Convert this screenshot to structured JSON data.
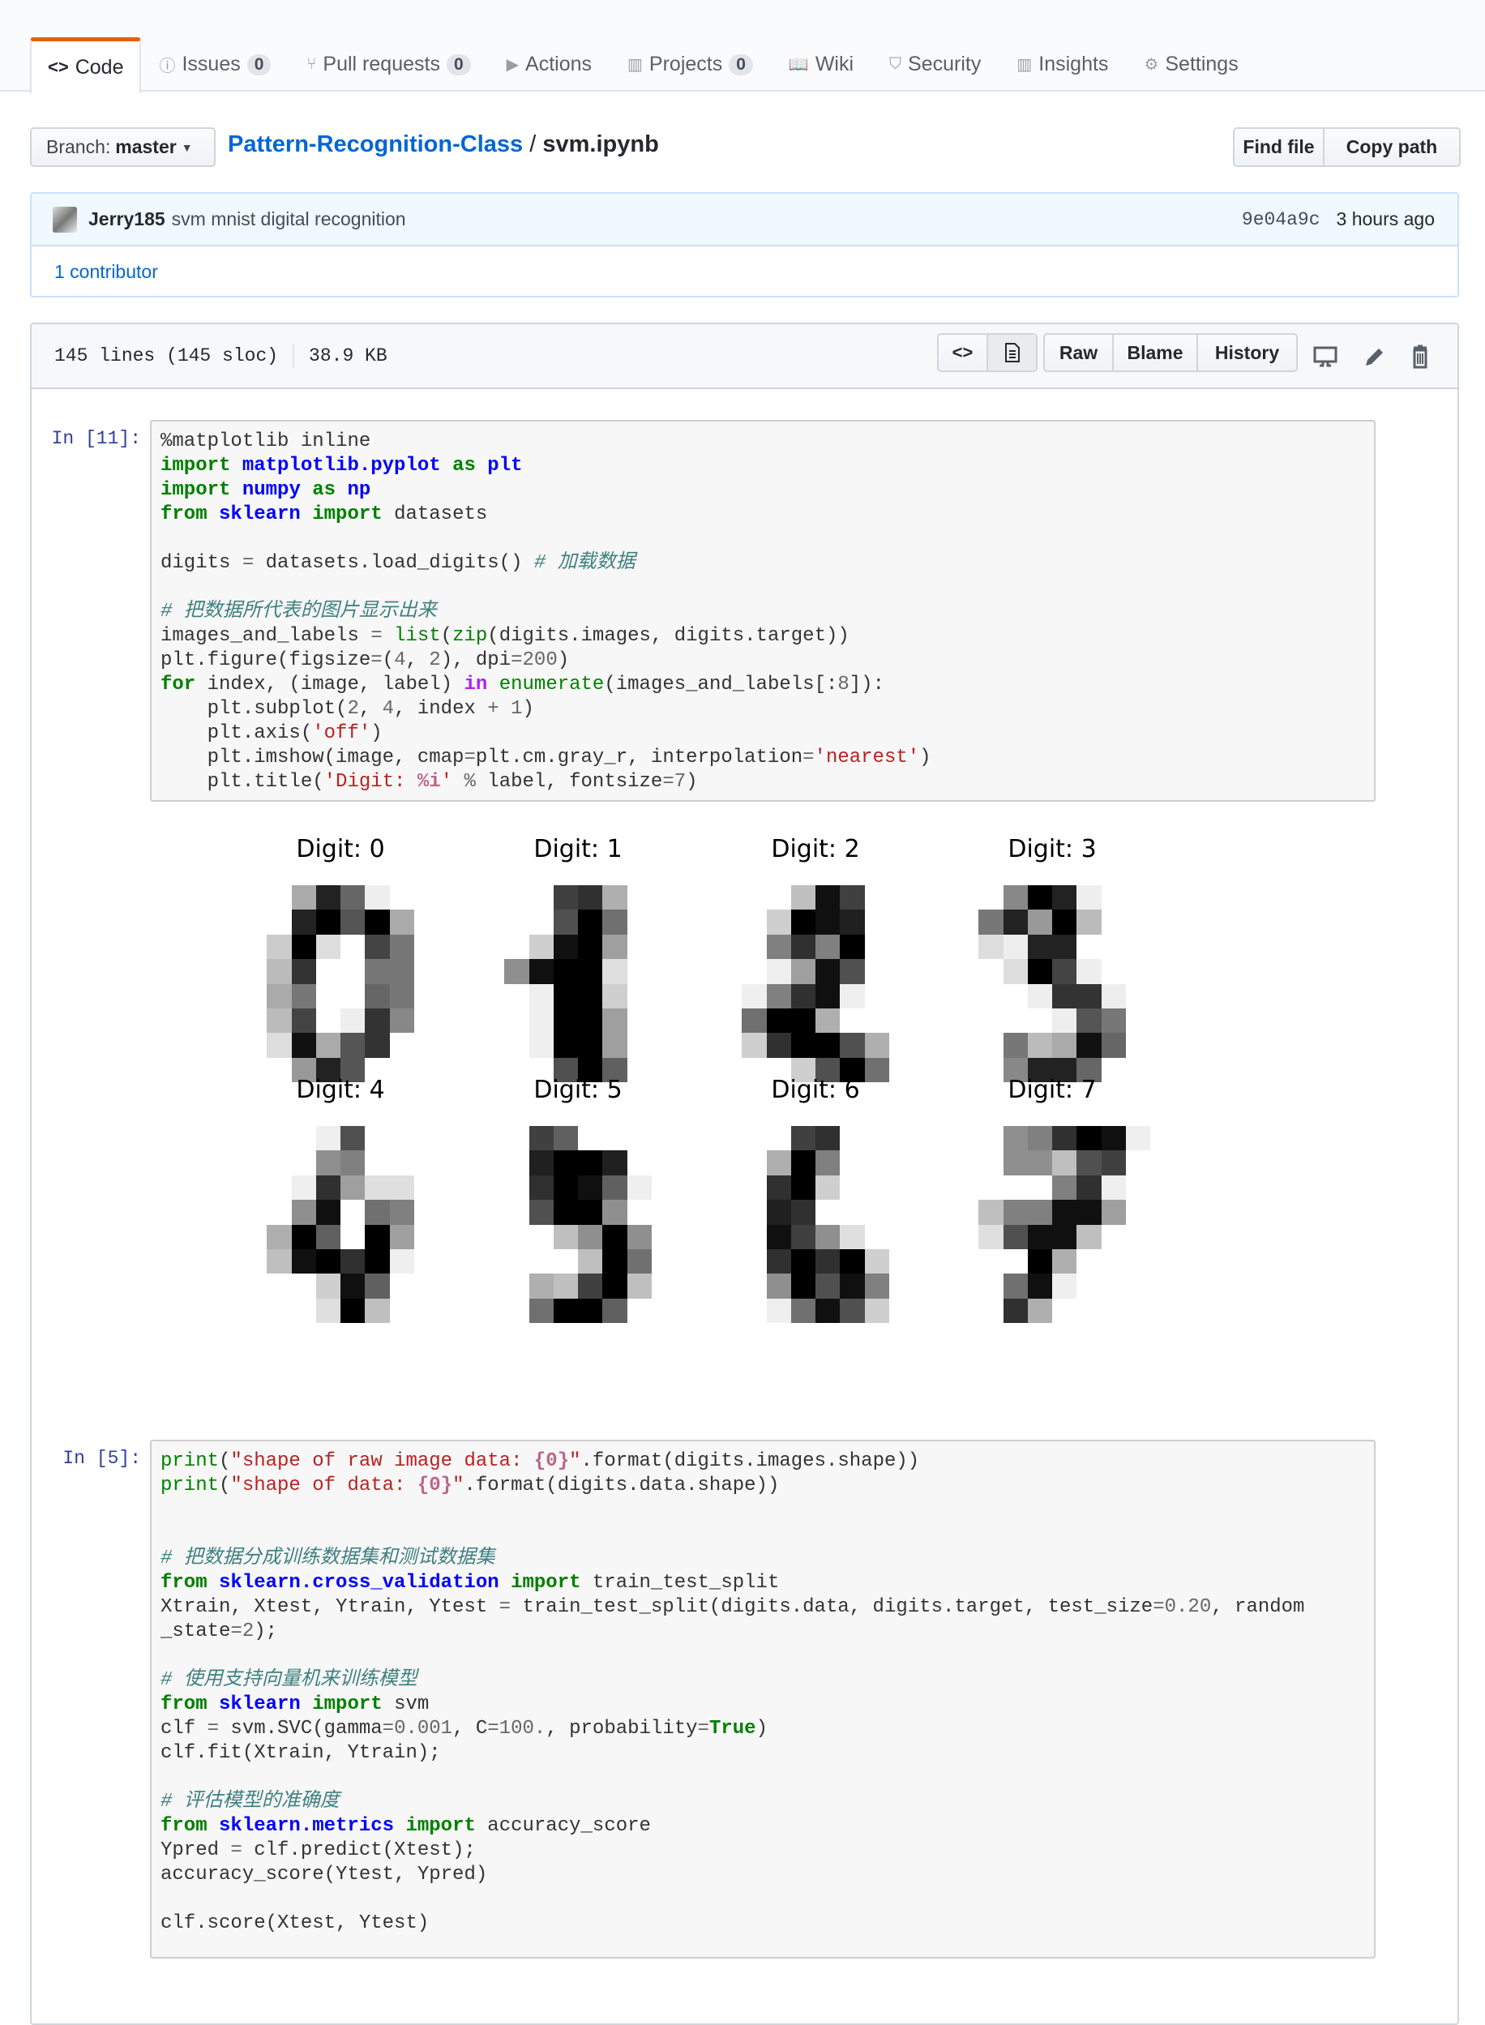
{
  "tabs": [
    {
      "label": "Code",
      "icon": "code-icon",
      "selected": true
    },
    {
      "label": "Issues",
      "count": "0",
      "icon": "issue-icon"
    },
    {
      "label": "Pull requests",
      "count": "0",
      "icon": "pull-request-icon"
    },
    {
      "label": "Actions",
      "icon": "play-icon"
    },
    {
      "label": "Projects",
      "count": "0",
      "icon": "project-icon"
    },
    {
      "label": "Wiki",
      "icon": "book-icon"
    },
    {
      "label": "Security",
      "icon": "shield-icon"
    },
    {
      "label": "Insights",
      "icon": "graph-icon"
    },
    {
      "label": "Settings",
      "icon": "gear-icon"
    }
  ],
  "branch": {
    "label": "Branch:",
    "value": "master"
  },
  "breadcrumb": {
    "repo": "Pattern-Recognition-Class",
    "sep": "/",
    "file": "svm.ipynb"
  },
  "actions": {
    "find_file": "Find file",
    "copy_path": "Copy path"
  },
  "commit": {
    "author": "Jerry185",
    "message": "svm mnist digital recognition",
    "sha": "9e04a9c",
    "time": "3 hours ago",
    "contributors": "1 contributor"
  },
  "file": {
    "lines": "145 lines (145 sloc)",
    "size": "38.9 KB",
    "raw": "Raw",
    "blame": "Blame",
    "history": "History"
  },
  "cells": [
    {
      "prompt": "In [11]:",
      "lines": [
        [
          [
            "%matplotlib inline",
            ""
          ]
        ],
        [
          [
            "import",
            "kw"
          ],
          [
            " ",
            ""
          ],
          [
            "matplotlib.pyplot",
            "nm"
          ],
          [
            " ",
            ""
          ],
          [
            "as",
            "kw"
          ],
          [
            " ",
            ""
          ],
          [
            "plt",
            "nm"
          ]
        ],
        [
          [
            "import",
            "kw"
          ],
          [
            " ",
            ""
          ],
          [
            "numpy",
            "nm"
          ],
          [
            " ",
            ""
          ],
          [
            "as",
            "kw"
          ],
          [
            " ",
            ""
          ],
          [
            "np",
            "nm"
          ]
        ],
        [
          [
            "from",
            "kw"
          ],
          [
            " ",
            ""
          ],
          [
            "sklearn",
            "nm"
          ],
          [
            " ",
            ""
          ],
          [
            "import",
            "kw"
          ],
          [
            " datasets",
            ""
          ]
        ],
        [],
        [
          [
            "digits ",
            ""
          ],
          [
            "=",
            "op"
          ],
          [
            " datasets.load_digits() ",
            ""
          ],
          [
            "# 加载数据",
            "cm"
          ]
        ],
        [],
        [
          [
            "# 把数据所代表的图片显示出来",
            "cm"
          ]
        ],
        [
          [
            "images_and_labels ",
            ""
          ],
          [
            "=",
            "op"
          ],
          [
            " ",
            ""
          ],
          [
            "list",
            "bi"
          ],
          [
            "(",
            ""
          ],
          [
            "zip",
            "bi"
          ],
          [
            "(digits.images, digits.target))",
            ""
          ]
        ],
        [
          [
            "plt.figure(figsize",
            ""
          ],
          [
            "=",
            "op"
          ],
          [
            "(",
            ""
          ],
          [
            "4",
            "num"
          ],
          [
            ", ",
            ""
          ],
          [
            "2",
            "num"
          ],
          [
            "), dpi",
            ""
          ],
          [
            "=",
            "op"
          ],
          [
            "200",
            "num"
          ],
          [
            ")",
            ""
          ]
        ],
        [
          [
            "for",
            "kw"
          ],
          [
            " index, (image, label) ",
            ""
          ],
          [
            "in",
            "ow"
          ],
          [
            " ",
            ""
          ],
          [
            "enumerate",
            "bi"
          ],
          [
            "(images_and_labels[:",
            ""
          ],
          [
            "8",
            "num"
          ],
          [
            "]):",
            ""
          ]
        ],
        [
          [
            "    plt.subplot(",
            ""
          ],
          [
            "2",
            "num"
          ],
          [
            ", ",
            ""
          ],
          [
            "4",
            "num"
          ],
          [
            ", index ",
            ""
          ],
          [
            "+",
            "op"
          ],
          [
            " ",
            ""
          ],
          [
            "1",
            "num"
          ],
          [
            ")",
            ""
          ]
        ],
        [
          [
            "    plt.axis(",
            ""
          ],
          [
            "'off'",
            "s"
          ],
          [
            ")",
            ""
          ]
        ],
        [
          [
            "    plt.imshow(image, cmap",
            ""
          ],
          [
            "=",
            "op"
          ],
          [
            "plt.cm.gray_r, interpolation",
            ""
          ],
          [
            "=",
            "op"
          ],
          [
            "'nearest'",
            "s"
          ],
          [
            ")",
            ""
          ]
        ],
        [
          [
            "    plt.title(",
            ""
          ],
          [
            "'Digit: ",
            "s"
          ],
          [
            "%i",
            "si"
          ],
          [
            "'",
            "s"
          ],
          [
            " ",
            ""
          ],
          [
            "%",
            "op"
          ],
          [
            " label, fontsize",
            ""
          ],
          [
            "=",
            "op"
          ],
          [
            "7",
            "num"
          ],
          [
            ")",
            ""
          ]
        ]
      ]
    },
    {
      "prompt": "In [5]:",
      "lines": [
        [
          [
            "print",
            "bi"
          ],
          [
            "(",
            ""
          ],
          [
            "\"shape of raw image data: ",
            "s"
          ],
          [
            "{0}",
            "si"
          ],
          [
            "\"",
            "s"
          ],
          [
            ".format(digits.images.shape))",
            ""
          ]
        ],
        [
          [
            "print",
            "bi"
          ],
          [
            "(",
            ""
          ],
          [
            "\"shape of data: ",
            "s"
          ],
          [
            "{0}",
            "si"
          ],
          [
            "\"",
            "s"
          ],
          [
            ".format(digits.data.shape))",
            ""
          ]
        ],
        [],
        [],
        [
          [
            "# 把数据分成训练数据集和测试数据集",
            "cm"
          ]
        ],
        [
          [
            "from",
            "kw"
          ],
          [
            " ",
            ""
          ],
          [
            "sklearn.cross_validation",
            "nm"
          ],
          [
            " ",
            ""
          ],
          [
            "import",
            "kw"
          ],
          [
            " train_test_split",
            ""
          ]
        ],
        [
          [
            "Xtrain, Xtest, Ytrain, Ytest ",
            ""
          ],
          [
            "=",
            "op"
          ],
          [
            " train_test_split(digits.data, digits.target, test_size",
            ""
          ],
          [
            "=",
            "op"
          ],
          [
            "0.20",
            "num"
          ],
          [
            ", random",
            ""
          ]
        ],
        [
          [
            "_state",
            ""
          ],
          [
            "=",
            "op"
          ],
          [
            "2",
            "num"
          ],
          [
            ");",
            ""
          ]
        ],
        [],
        [
          [
            "# 使用支持向量机来训练模型",
            "cm"
          ]
        ],
        [
          [
            "from",
            "kw"
          ],
          [
            " ",
            ""
          ],
          [
            "sklearn",
            "nm"
          ],
          [
            " ",
            ""
          ],
          [
            "import",
            "kw"
          ],
          [
            " svm",
            ""
          ]
        ],
        [
          [
            "clf ",
            ""
          ],
          [
            "=",
            "op"
          ],
          [
            " svm.SVC(gamma",
            ""
          ],
          [
            "=",
            "op"
          ],
          [
            "0.001",
            "num"
          ],
          [
            ", C",
            ""
          ],
          [
            "=",
            "op"
          ],
          [
            "100.",
            "num"
          ],
          [
            ", probability",
            ""
          ],
          [
            "=",
            "op"
          ],
          [
            "True",
            "kw"
          ],
          [
            ")",
            ""
          ]
        ],
        [
          [
            "clf.fit(Xtrain, Ytrain);",
            ""
          ]
        ],
        [],
        [
          [
            "# 评估模型的准确度",
            "cm"
          ]
        ],
        [
          [
            "from",
            "kw"
          ],
          [
            " ",
            ""
          ],
          [
            "sklearn.metrics",
            "nm"
          ],
          [
            " ",
            ""
          ],
          [
            "import",
            "kw"
          ],
          [
            " accuracy_score",
            ""
          ]
        ],
        [
          [
            "Ypred ",
            ""
          ],
          [
            "=",
            "op"
          ],
          [
            " clf.predict(Xtest);",
            ""
          ]
        ],
        [
          [
            "accuracy_score(Ytest, Ypred)",
            ""
          ]
        ],
        [],
        [
          [
            "clf.score(Xtest, Ytest)",
            ""
          ]
        ]
      ]
    }
  ],
  "figure": {
    "titles": [
      "Digit: 0",
      "Digit: 1",
      "Digit: 2",
      "Digit: 3",
      "Digit: 4",
      "Digit: 5",
      "Digit: 6",
      "Digit: 7"
    ],
    "pixel_max": 16,
    "images": [
      [
        [
          0,
          0,
          5,
          13,
          9,
          1,
          0,
          0
        ],
        [
          0,
          0,
          13,
          15,
          10,
          15,
          5,
          0
        ],
        [
          0,
          3,
          15,
          2,
          0,
          11,
          8,
          0
        ],
        [
          0,
          4,
          12,
          0,
          0,
          8,
          8,
          0
        ],
        [
          0,
          5,
          8,
          0,
          0,
          9,
          8,
          0
        ],
        [
          0,
          4,
          11,
          0,
          1,
          12,
          7,
          0
        ],
        [
          0,
          2,
          14,
          5,
          10,
          12,
          0,
          0
        ],
        [
          0,
          0,
          6,
          13,
          10,
          0,
          0,
          0
        ]
      ],
      [
        [
          0,
          0,
          0,
          12,
          13,
          5,
          0,
          0
        ],
        [
          0,
          0,
          0,
          11,
          16,
          9,
          0,
          0
        ],
        [
          0,
          0,
          3,
          15,
          16,
          6,
          0,
          0
        ],
        [
          0,
          7,
          15,
          16,
          16,
          2,
          0,
          0
        ],
        [
          0,
          0,
          1,
          16,
          16,
          3,
          0,
          0
        ],
        [
          0,
          0,
          1,
          16,
          16,
          6,
          0,
          0
        ],
        [
          0,
          0,
          1,
          16,
          16,
          6,
          0,
          0
        ],
        [
          0,
          0,
          0,
          11,
          16,
          10,
          0,
          0
        ]
      ],
      [
        [
          0,
          0,
          0,
          4,
          15,
          12,
          0,
          0
        ],
        [
          0,
          0,
          3,
          16,
          15,
          14,
          0,
          0
        ],
        [
          0,
          0,
          8,
          13,
          8,
          16,
          0,
          0
        ],
        [
          0,
          0,
          1,
          6,
          15,
          11,
          0,
          0
        ],
        [
          0,
          1,
          8,
          13,
          15,
          1,
          0,
          0
        ],
        [
          0,
          9,
          16,
          16,
          5,
          0,
          0,
          0
        ],
        [
          0,
          3,
          13,
          16,
          16,
          11,
          5,
          0
        ],
        [
          0,
          0,
          0,
          3,
          11,
          16,
          9,
          0
        ]
      ],
      [
        [
          0,
          0,
          7,
          15,
          13,
          1,
          0,
          0
        ],
        [
          0,
          8,
          13,
          6,
          15,
          4,
          0,
          0
        ],
        [
          0,
          2,
          1,
          13,
          13,
          0,
          0,
          0
        ],
        [
          0,
          0,
          2,
          15,
          11,
          1,
          0,
          0
        ],
        [
          0,
          0,
          0,
          1,
          12,
          12,
          1,
          0
        ],
        [
          0,
          0,
          0,
          0,
          1,
          10,
          8,
          0
        ],
        [
          0,
          0,
          8,
          4,
          5,
          14,
          9,
          0
        ],
        [
          0,
          0,
          7,
          13,
          13,
          9,
          0,
          0
        ]
      ],
      [
        [
          0,
          0,
          0,
          1,
          11,
          0,
          0,
          0
        ],
        [
          0,
          0,
          0,
          7,
          8,
          0,
          0,
          0
        ],
        [
          0,
          0,
          1,
          13,
          6,
          2,
          2,
          0
        ],
        [
          0,
          0,
          7,
          15,
          0,
          9,
          8,
          0
        ],
        [
          0,
          5,
          16,
          10,
          0,
          16,
          6,
          0
        ],
        [
          0,
          4,
          15,
          16,
          13,
          16,
          1,
          0
        ],
        [
          0,
          0,
          0,
          3,
          15,
          10,
          0,
          0
        ],
        [
          0,
          0,
          0,
          2,
          16,
          4,
          0,
          0
        ]
      ],
      [
        [
          0,
          0,
          12,
          10,
          0,
          0,
          0,
          0
        ],
        [
          0,
          0,
          14,
          16,
          16,
          14,
          0,
          0
        ],
        [
          0,
          0,
          13,
          16,
          15,
          10,
          1,
          0
        ],
        [
          0,
          0,
          11,
          16,
          16,
          7,
          0,
          0
        ],
        [
          0,
          0,
          0,
          4,
          7,
          16,
          7,
          0
        ],
        [
          0,
          0,
          0,
          0,
          4,
          16,
          9,
          0
        ],
        [
          0,
          0,
          5,
          4,
          12,
          16,
          4,
          0
        ],
        [
          0,
          0,
          9,
          16,
          16,
          10,
          0,
          0
        ]
      ],
      [
        [
          0,
          0,
          0,
          12,
          13,
          0,
          0,
          0
        ],
        [
          0,
          0,
          5,
          16,
          8,
          0,
          0,
          0
        ],
        [
          0,
          0,
          13,
          16,
          3,
          0,
          0,
          0
        ],
        [
          0,
          0,
          14,
          13,
          0,
          0,
          0,
          0
        ],
        [
          0,
          0,
          15,
          12,
          7,
          2,
          0,
          0
        ],
        [
          0,
          0,
          13,
          16,
          13,
          16,
          3,
          0
        ],
        [
          0,
          0,
          7,
          16,
          11,
          15,
          8,
          0
        ],
        [
          0,
          0,
          1,
          9,
          15,
          11,
          3,
          0
        ]
      ],
      [
        [
          0,
          0,
          7,
          8,
          13,
          16,
          15,
          1
        ],
        [
          0,
          0,
          7,
          7,
          4,
          11,
          12,
          0
        ],
        [
          0,
          0,
          0,
          0,
          8,
          13,
          1,
          0
        ],
        [
          0,
          4,
          8,
          8,
          15,
          15,
          6,
          0
        ],
        [
          0,
          2,
          11,
          15,
          15,
          4,
          0,
          0
        ],
        [
          0,
          0,
          0,
          16,
          5,
          0,
          0,
          0
        ],
        [
          0,
          0,
          9,
          15,
          1,
          0,
          0,
          0
        ],
        [
          0,
          0,
          13,
          5,
          0,
          0,
          0,
          0
        ]
      ]
    ]
  },
  "colors": {
    "accent": "#e36209",
    "link": "#0366d6",
    "prompt": "#303f9f"
  }
}
